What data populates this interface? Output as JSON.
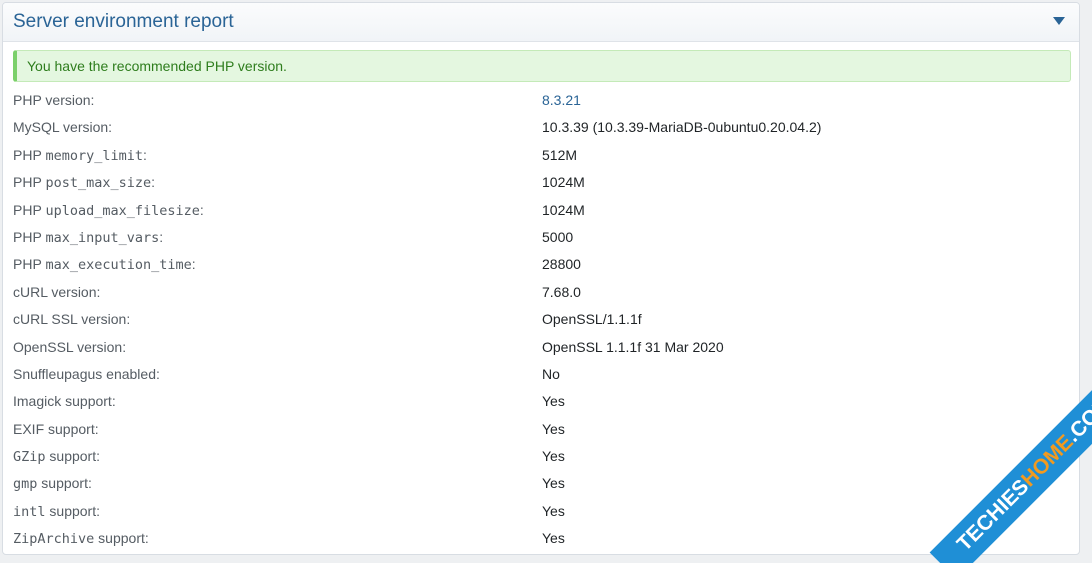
{
  "panel": {
    "title": "Server environment report"
  },
  "alert": {
    "text": "You have the recommended PHP version."
  },
  "rows": [
    {
      "prefix": "",
      "code": "",
      "suffix": "PHP version:",
      "value": "8.3.21",
      "link": true
    },
    {
      "prefix": "",
      "code": "",
      "suffix": "MySQL version:",
      "value": "10.3.39 (10.3.39-MariaDB-0ubuntu0.20.04.2)",
      "link": false
    },
    {
      "prefix": "PHP ",
      "code": "memory_limit",
      "suffix": ":",
      "value": "512M",
      "link": false
    },
    {
      "prefix": "PHP ",
      "code": "post_max_size",
      "suffix": ":",
      "value": "1024M",
      "link": false
    },
    {
      "prefix": "PHP ",
      "code": "upload_max_filesize",
      "suffix": ":",
      "value": "1024M",
      "link": false
    },
    {
      "prefix": "PHP ",
      "code": "max_input_vars",
      "suffix": ":",
      "value": "5000",
      "link": false
    },
    {
      "prefix": "PHP ",
      "code": "max_execution_time",
      "suffix": ":",
      "value": "28800",
      "link": false
    },
    {
      "prefix": "",
      "code": "",
      "suffix": "cURL version:",
      "value": "7.68.0",
      "link": false
    },
    {
      "prefix": "",
      "code": "",
      "suffix": "cURL SSL version:",
      "value": "OpenSSL/1.1.1f",
      "link": false
    },
    {
      "prefix": "",
      "code": "",
      "suffix": "OpenSSL version:",
      "value": "OpenSSL 1.1.1f 31 Mar 2020",
      "link": false
    },
    {
      "prefix": "",
      "code": "",
      "suffix": "Snuffleupagus enabled:",
      "value": "No",
      "link": false
    },
    {
      "prefix": "",
      "code": "",
      "suffix": "Imagick support:",
      "value": "Yes",
      "link": false
    },
    {
      "prefix": "",
      "code": "",
      "suffix": "EXIF support:",
      "value": "Yes",
      "link": false
    },
    {
      "prefix": "",
      "code": "GZip",
      "suffix": " support:",
      "value": "Yes",
      "link": false
    },
    {
      "prefix": "",
      "code": "gmp",
      "suffix": " support:",
      "value": "Yes",
      "link": false
    },
    {
      "prefix": "",
      "code": "intl",
      "suffix": " support:",
      "value": "Yes",
      "link": false
    },
    {
      "prefix": "",
      "code": "ZipArchive",
      "suffix": " support:",
      "value": "Yes",
      "link": false
    }
  ],
  "watermark": {
    "part1": "TECHIES",
    "part2": "HOME",
    "part3": ".COM"
  }
}
